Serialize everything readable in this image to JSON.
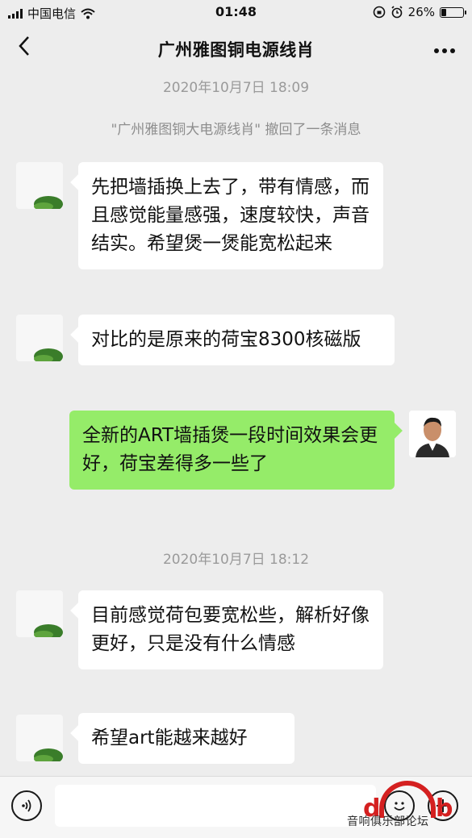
{
  "status": {
    "carrier": "中国电信",
    "time": "01:48",
    "battery": "26%",
    "battery_level": 0.26
  },
  "nav": {
    "title": "广州雅图铜电源线肖"
  },
  "chat": {
    "time1": "2020年10月7日 18:09",
    "recall": "\"广州雅图铜大电源线肖\" 撤回了一条消息",
    "msg1": "先把墙插换上去了，带有情感，而且感觉能量感强，速度较快，声音结实。希望煲一煲能宽松起来",
    "msg2": "对比的是原来的荷宝8300核磁版",
    "msg3": "全新的ART墙插煲一段时间效果会更好，荷宝差得多一些了",
    "time2": "2020年10月7日 18:12",
    "msg4": "目前感觉荷包要宽松些，解析好像更好，只是没有什么情感",
    "msg5": "希望art能越来越好"
  },
  "watermark": {
    "text": "音响俱乐部论坛",
    "accent": "#d42020"
  },
  "colors": {
    "background": "#ededed",
    "incoming_bubble": "#ffffff",
    "outgoing_bubble": "#95ec69"
  }
}
